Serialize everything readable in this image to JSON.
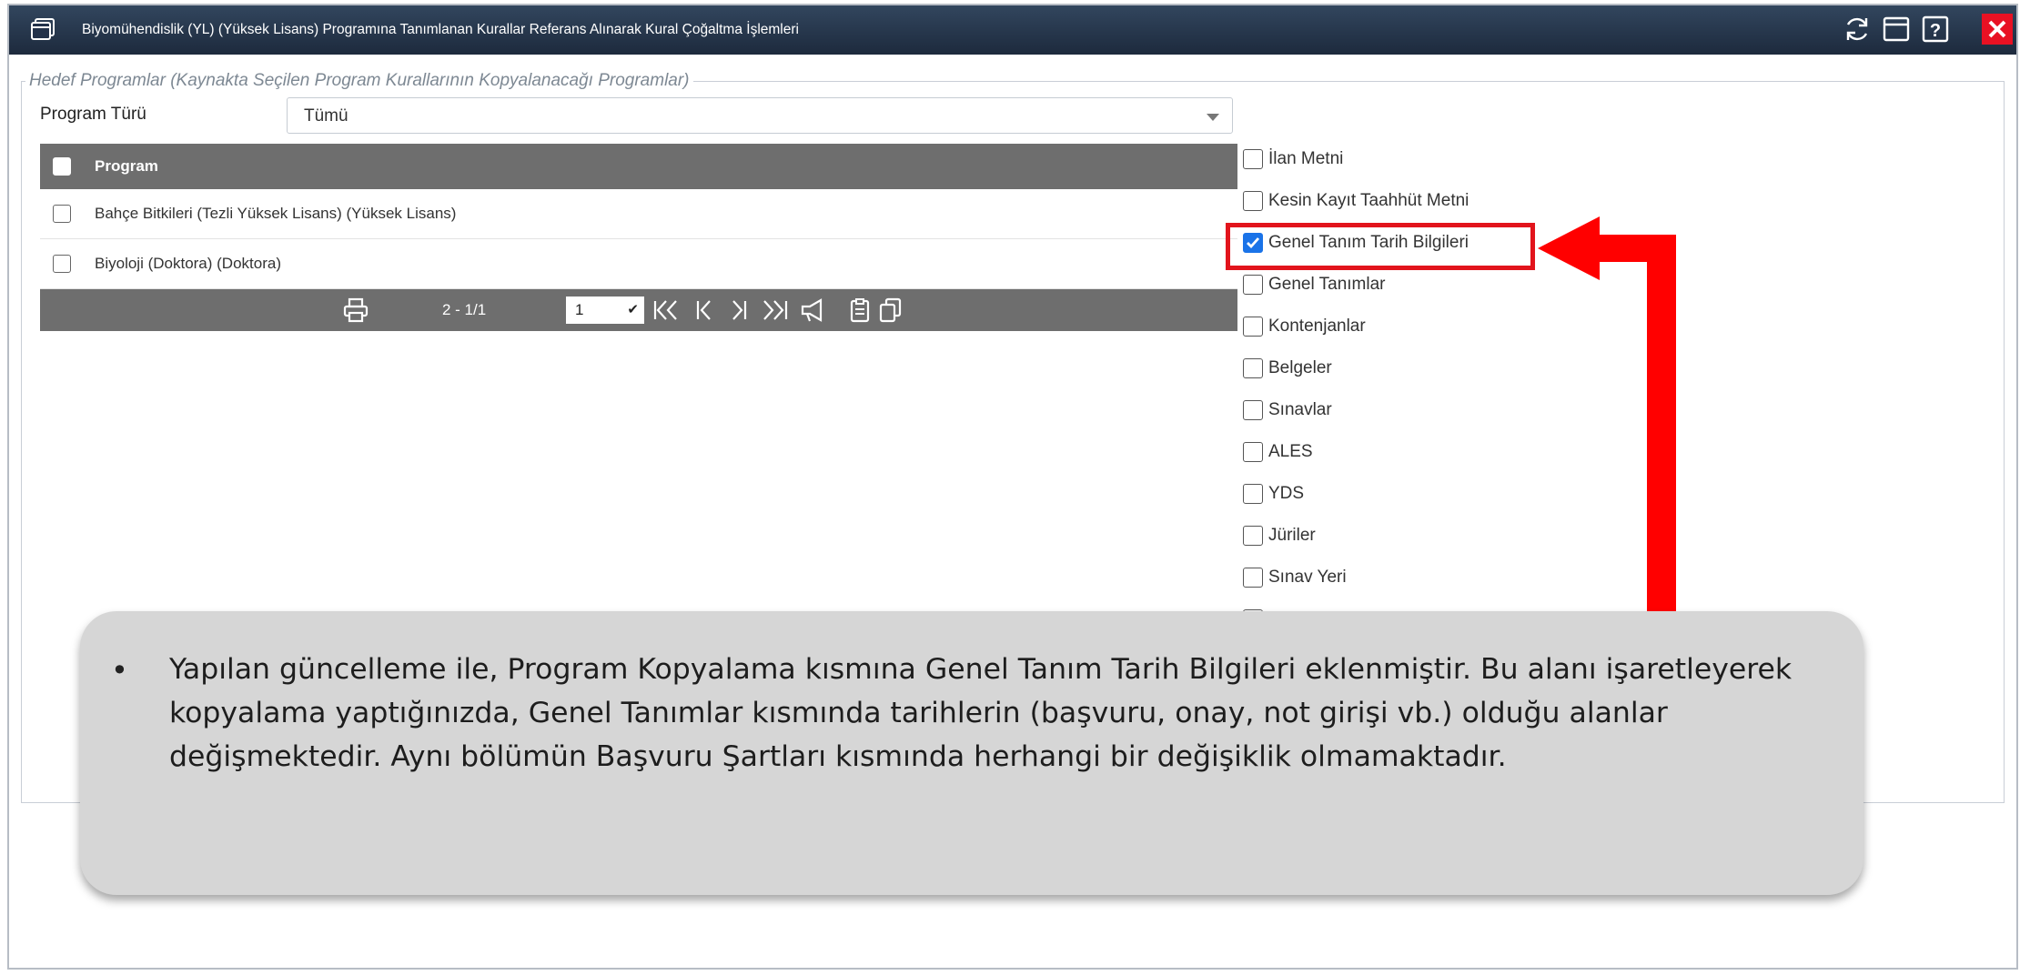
{
  "window": {
    "title": "Biyomühendislik (YL) (Yüksek Lisans) Programına Tanımlanan Kurallar Referans Alınarak Kural Çoğaltma İşlemleri"
  },
  "titlebar_buttons": [
    "refresh-icon",
    "maximize-icon",
    "help-icon",
    "close-icon"
  ],
  "target_section": {
    "legend": "Hedef Programlar (Kaynakta Seçilen Program Kurallarının Kopyalanacağı Programlar)",
    "program_type_label": "Program Türü",
    "program_type_value": "Tümü"
  },
  "grid": {
    "header": "Program",
    "rows": [
      {
        "name": "Bahçe Bitkileri (Tezli Yüksek Lisans) (Yüksek Lisans)",
        "checked": false
      },
      {
        "name": "Biyoloji (Doktora) (Doktora)",
        "checked": false
      }
    ],
    "pager": {
      "info": "2 - 1/1",
      "page": "1"
    }
  },
  "copy_options": [
    {
      "label": "İlan Metni",
      "checked": false
    },
    {
      "label": "Kesin Kayıt Taahhüt Metni",
      "checked": false
    },
    {
      "label": "Genel Tanım Tarih Bilgileri",
      "checked": true
    },
    {
      "label": "Genel Tanımlar",
      "checked": false
    },
    {
      "label": "Kontenjanlar",
      "checked": false
    },
    {
      "label": "Belgeler",
      "checked": false
    },
    {
      "label": "Sınavlar",
      "checked": false
    },
    {
      "label": "ALES",
      "checked": false
    },
    {
      "label": "YDS",
      "checked": false
    },
    {
      "label": "Jüriler",
      "checked": false
    },
    {
      "label": "Sınav Yeri",
      "checked": false
    }
  ],
  "callout": {
    "bullet": "•",
    "text": "Yapılan güncelleme ile, Program Kopyalama kısmına Genel Tanım Tarih Bilgileri eklenmiştir. Bu alanı işaretleyerek kopyalama yaptığınızda, Genel Tanımlar kısmında tarihlerin (başvuru, onay, not girişi vb.) olduğu alanlar değişmektedir. Aynı bölümün Başvuru Şartları kısmında herhangi bir değişiklik olmamaktadır."
  },
  "colors": {
    "titlebar": "#23324a",
    "accent_red": "#e2141c",
    "grid_header": "#6e6e6e",
    "checkbox_checked": "#1a73e8"
  }
}
